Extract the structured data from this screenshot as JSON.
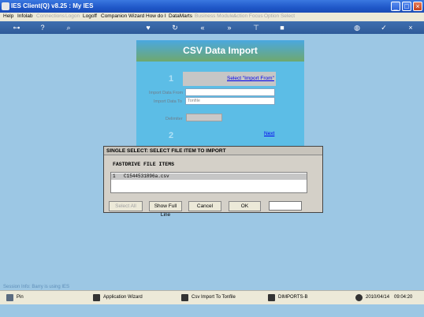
{
  "window": {
    "title": "IES Client(Q) v8.25 : My IES"
  },
  "menu": [
    {
      "label": "Help",
      "dim": false
    },
    {
      "label": "Infolab",
      "dim": false
    },
    {
      "label": "Connections",
      "dim": true
    },
    {
      "label": "Logon",
      "dim": true
    },
    {
      "label": "Logoff",
      "dim": false
    },
    {
      "label": "Companion",
      "dim": false
    },
    {
      "label": "Wizard",
      "dim": false
    },
    {
      "label": "How do I",
      "dim": false
    },
    {
      "label": "DataMarts",
      "dim": false
    },
    {
      "label": "Business Modules",
      "dim": true
    },
    {
      "label": "Action Focus",
      "dim": true
    },
    {
      "label": "Option Select",
      "dim": true
    }
  ],
  "csv": {
    "title": "CSV Data Import",
    "step1": "1",
    "select_link": "Select \"Import From\"",
    "import_from_label": "Import Data From",
    "import_to_label": "Import Data To",
    "import_to_value": "Tonfile",
    "delimiter_label": "Delimiter",
    "step2": "2",
    "next_link": "Next"
  },
  "dialog": {
    "title": "SINGLE SELECT: SELECT FILE ITEM TO IMPORT",
    "subtitle": "FASTDRIVE FILE ITEMS",
    "row_index": "1",
    "row_file": "C1544531896a.csv",
    "buttons": {
      "dim": "Select All",
      "show_full": "Show Full Line",
      "cancel": "Cancel",
      "ok": "OK"
    }
  },
  "session": "Session Info: Barry is using IES",
  "taskbar": {
    "pin": "Pin",
    "wizard": "Application Wizard",
    "csv_import": "Csv Import To Tonfile",
    "dimports": "DIMPORTS-B",
    "date": "2010/04/14",
    "time": "09:04:20"
  }
}
